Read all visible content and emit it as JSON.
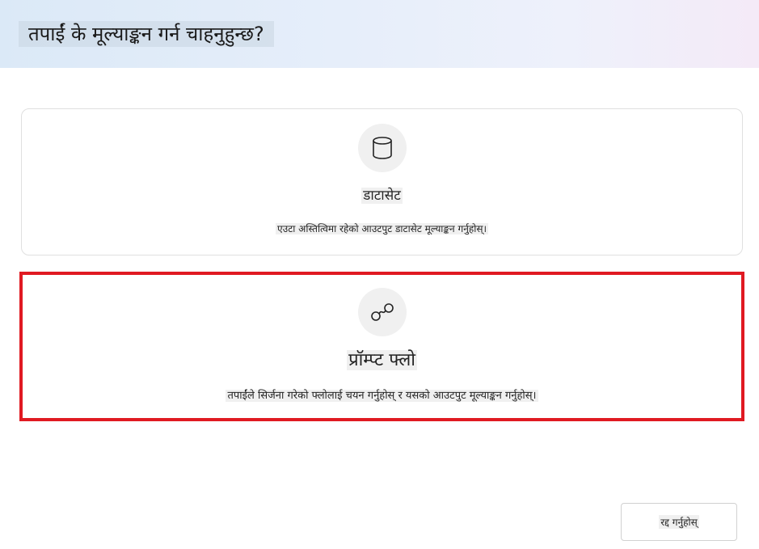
{
  "dialog": {
    "title": "तपाईं के मूल्याङ्कन गर्न चाहनुहुन्छ?"
  },
  "options": [
    {
      "title": "डाटासेट",
      "description": "एउटा अस्तित्विमा रहेको आउटपुट डाटासेट मूल्याङ्कन गर्नुहोस्।",
      "icon": "database-icon",
      "selected": false
    },
    {
      "title": "प्रॉम्प्ट फ्लो",
      "description": "तपाईंले सिर्जना गरेको फ्लोलाई चयन गर्नुहोस् र यसको आउटपुट मूल्याङ्कन गर्नुहोस्।",
      "icon": "flow-icon",
      "selected": true
    }
  ],
  "footer": {
    "cancel_label": "रद्द गर्नुहोस्"
  },
  "colors": {
    "selection_border": "#e01a22",
    "icon_bg": "#f0f0f0"
  }
}
